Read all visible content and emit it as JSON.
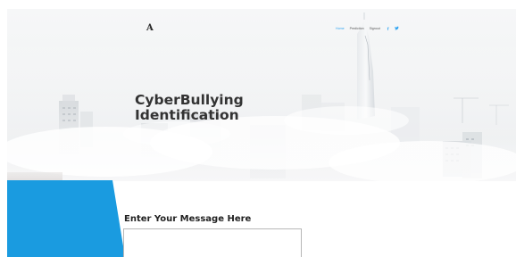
{
  "header": {
    "logo_text": "A",
    "nav": [
      {
        "label": "Home",
        "active": true
      },
      {
        "label": "Prediction",
        "active": false
      },
      {
        "label": "Signout",
        "active": false
      }
    ],
    "social": [
      {
        "icon": "facebook-icon",
        "glyph": "f"
      },
      {
        "icon": "twitter-icon",
        "glyph": "t"
      }
    ]
  },
  "hero": {
    "title_line1": "CyberBullying",
    "title_line2": "Identification"
  },
  "form": {
    "label": "Enter Your Message Here",
    "message_value": "",
    "message_placeholder": ""
  },
  "colors": {
    "accent": "#2ea3f2",
    "blue_shape": "#1a9be0",
    "title": "#333333"
  }
}
